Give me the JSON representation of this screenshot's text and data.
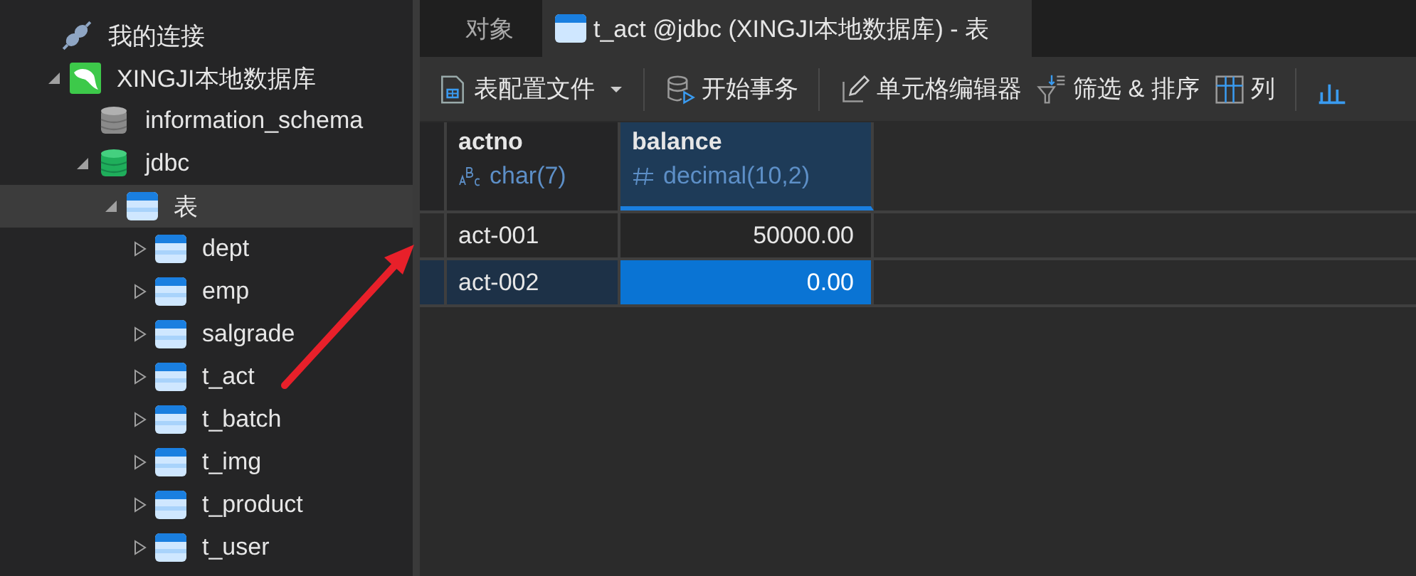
{
  "sidebar": {
    "tree": [
      {
        "label": "我的连接",
        "kind": "group",
        "selected": false,
        "children": [
          {
            "label": "XINGJI本地数据库",
            "kind": "connection",
            "expanded": true,
            "selected": false,
            "children": [
              {
                "label": "information_schema",
                "kind": "database",
                "open": false,
                "selected": false
              },
              {
                "label": "jdbc",
                "kind": "database",
                "open": true,
                "expanded": true,
                "selected": false,
                "children": [
                  {
                    "label": "表",
                    "kind": "folder",
                    "expanded": true,
                    "selected": true,
                    "children": [
                      {
                        "label": "dept",
                        "kind": "table",
                        "expanded": false,
                        "selected": false
                      },
                      {
                        "label": "emp",
                        "kind": "table",
                        "expanded": false,
                        "selected": false
                      },
                      {
                        "label": "salgrade",
                        "kind": "table",
                        "expanded": false,
                        "selected": false
                      },
                      {
                        "label": "t_act",
                        "kind": "table",
                        "expanded": false,
                        "selected": false
                      },
                      {
                        "label": "t_batch",
                        "kind": "table",
                        "expanded": false,
                        "selected": false
                      },
                      {
                        "label": "t_img",
                        "kind": "table",
                        "expanded": false,
                        "selected": false
                      },
                      {
                        "label": "t_product",
                        "kind": "table",
                        "expanded": false,
                        "selected": false
                      },
                      {
                        "label": "t_user",
                        "kind": "table",
                        "expanded": false,
                        "selected": false
                      }
                    ]
                  }
                ]
              }
            ]
          }
        ]
      }
    ]
  },
  "tabs": [
    {
      "label": "对象",
      "selected": false,
      "kind": "plain"
    },
    {
      "label": "t_act @jdbc (XINGJI本地数据库) - 表",
      "selected": true,
      "kind": "table"
    }
  ],
  "toolbar": [
    {
      "label": "表配置文件",
      "kind": "profile",
      "dropdown": true
    },
    {
      "label": "开始事务",
      "kind": "transaction"
    },
    {
      "label": "单元格编辑器",
      "kind": "editor"
    },
    {
      "label": "筛选 & 排序",
      "kind": "filter"
    },
    {
      "label": "列",
      "kind": "columns"
    },
    {
      "kind": "chart"
    }
  ],
  "grid": {
    "columns": [
      {
        "name": "actno",
        "type": "char(7)",
        "kind": "text",
        "selected": false
      },
      {
        "name": "balance",
        "type": "decimal(10,2)",
        "kind": "number",
        "selected": true
      }
    ],
    "rows": [
      {
        "selected": false,
        "cells": [
          {
            "text": "act-001",
            "selected": false
          },
          {
            "text": "50000.00",
            "selected": false
          }
        ]
      },
      {
        "selected": true,
        "cells": [
          {
            "text": "act-002",
            "selected": false
          },
          {
            "text": "0.00",
            "selected": true
          }
        ]
      }
    ]
  }
}
